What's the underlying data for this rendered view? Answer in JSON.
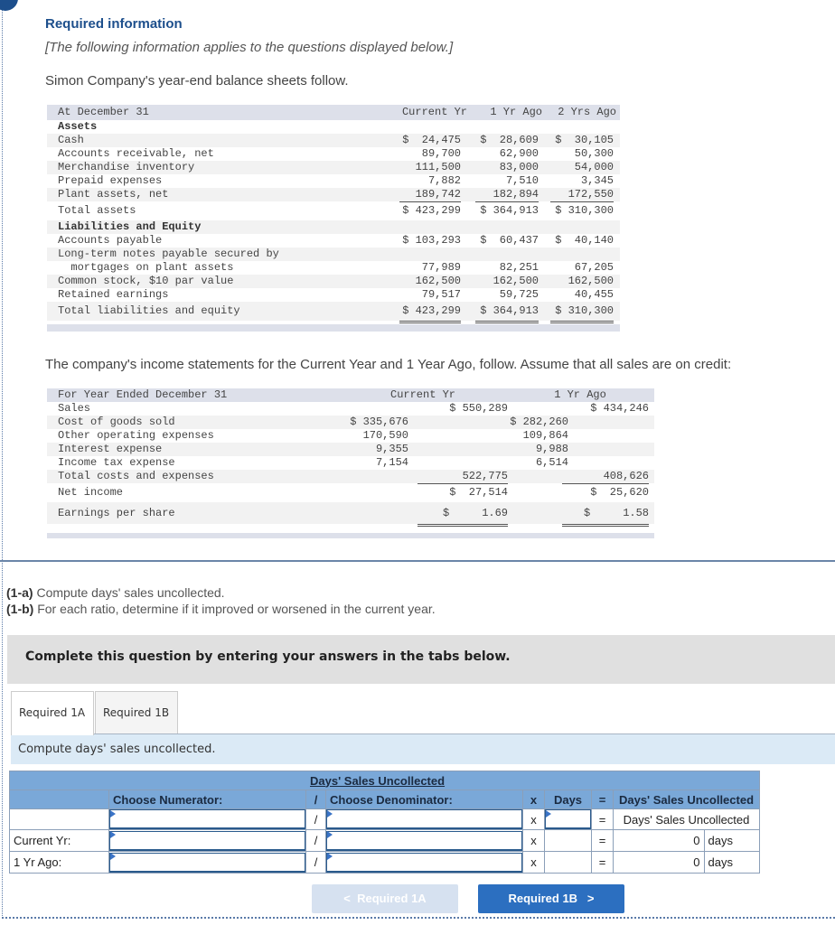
{
  "header": {
    "title": "Required information",
    "subtitle": "[The following information applies to the questions displayed below.]",
    "intro": "Simon Company's year-end balance sheets follow."
  },
  "balance_sheet": {
    "header_label": "At December 31",
    "columns": [
      "Current Yr",
      "1 Yr Ago",
      "2 Yrs Ago"
    ],
    "assets_heading": "Assets",
    "rows": [
      {
        "label": "Cash",
        "values": [
          "$  24,475",
          "$  28,609",
          "$  30,105"
        ]
      },
      {
        "label": "Accounts receivable, net",
        "values": [
          "89,700",
          "62,900",
          "50,300"
        ]
      },
      {
        "label": "Merchandise inventory",
        "values": [
          "111,500",
          "83,000",
          "54,000"
        ]
      },
      {
        "label": "Prepaid expenses",
        "values": [
          "7,882",
          "7,510",
          "3,345"
        ]
      },
      {
        "label": "Plant assets, net",
        "values": [
          "189,742",
          "182,894",
          "172,550"
        ]
      }
    ],
    "total_assets": {
      "label": "Total assets",
      "values": [
        "$ 423,299",
        "$ 364,913",
        "$ 310,300"
      ]
    },
    "liabilities_heading": "Liabilities and Equity",
    "liab_rows": [
      {
        "label": "Accounts payable",
        "values": [
          "$ 103,293",
          "$  60,437",
          "$  40,140"
        ]
      },
      {
        "label": "Long-term notes payable secured by",
        "values": [
          "",
          "",
          ""
        ]
      },
      {
        "label": "  mortgages on plant assets",
        "values": [
          "77,989",
          "82,251",
          "67,205"
        ]
      },
      {
        "label": "Common stock, $10 par value",
        "values": [
          "162,500",
          "162,500",
          "162,500"
        ]
      },
      {
        "label": "Retained earnings",
        "values": [
          "79,517",
          "59,725",
          "40,455"
        ]
      }
    ],
    "total_liab": {
      "label": "Total liabilities and equity",
      "values": [
        "$ 423,299",
        "$ 364,913",
        "$ 310,300"
      ]
    }
  },
  "income_intro": "The company's income statements for the Current Year and 1 Year Ago, follow. Assume that all sales are on credit:",
  "income_statement": {
    "header_label": "For Year Ended December 31",
    "columns": [
      "Current Yr",
      "1 Yr Ago"
    ],
    "sales": {
      "label": "Sales",
      "cur": "$ 550,289",
      "prev": "$ 434,246"
    },
    "expenses": [
      {
        "label": "Cost of goods sold",
        "cur": "$ 335,676",
        "prev": "$ 282,260"
      },
      {
        "label": "Other operating expenses",
        "cur": "170,590",
        "prev": "109,864"
      },
      {
        "label": "Interest expense",
        "cur": "9,355",
        "prev": "9,988"
      },
      {
        "label": "Income tax expense",
        "cur": "7,154",
        "prev": "6,514"
      }
    ],
    "total_costs": {
      "label": "Total costs and expenses",
      "cur": "522,775",
      "prev": "408,626"
    },
    "net_income": {
      "label": "Net income",
      "cur": "$  27,514",
      "prev": "$  25,620"
    },
    "eps": {
      "label": "Earnings per share",
      "cur": "$     1.69",
      "prev": "$     1.58"
    }
  },
  "questions": {
    "q1a_tag": "(1-a)",
    "q1a_text": " Compute days' sales uncollected.",
    "q1b_tag": "(1-b)",
    "q1b_text": " For each ratio, determine if it improved or worsened in the current year."
  },
  "banner": "Complete this question by entering your answers in the tabs below.",
  "tabs": [
    {
      "label": "Required 1A",
      "active": true
    },
    {
      "label": "Required 1B",
      "active": false
    }
  ],
  "panel_hint": "Compute days' sales uncollected.",
  "grid": {
    "title": "Days' Sales Uncollected",
    "numerator_header": "Choose Numerator:",
    "div_sym": "/",
    "denominator_header": "Choose Denominator:",
    "times_sym": "x",
    "days_header": "Days",
    "eq_sym": "=",
    "result_header": "Days' Sales Uncollected",
    "formula_row": {
      "label": "",
      "numerator": "",
      "denominator": "",
      "days": "",
      "result_text": "Days' Sales Uncollected"
    },
    "rows": [
      {
        "label": "Current Yr:",
        "numerator": "",
        "denominator": "",
        "value": "0",
        "unit": "days"
      },
      {
        "label": "1 Yr Ago:",
        "numerator": "",
        "denominator": "",
        "value": "0",
        "unit": "days"
      }
    ]
  },
  "nav": {
    "prev_label": "Required 1A",
    "next_label": "Required 1B",
    "prev_icon": "chevron-left-icon",
    "next_icon": "chevron-right-icon"
  }
}
